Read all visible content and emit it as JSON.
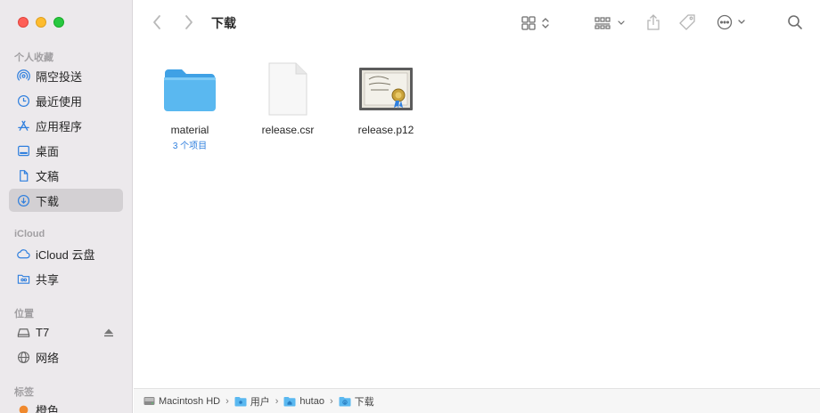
{
  "window": {
    "title": "下载"
  },
  "sidebar": {
    "sections": [
      {
        "title": "个人收藏"
      },
      {
        "title": "iCloud"
      },
      {
        "title": "位置"
      },
      {
        "title": "标签"
      }
    ],
    "favorites": [
      {
        "label": "隔空投送",
        "icon": "airdrop-icon"
      },
      {
        "label": "最近使用",
        "icon": "clock-icon"
      },
      {
        "label": "应用程序",
        "icon": "applications-icon"
      },
      {
        "label": "桌面",
        "icon": "desktop-icon"
      },
      {
        "label": "文稿",
        "icon": "document-icon"
      },
      {
        "label": "下载",
        "icon": "download-icon",
        "selected": true
      }
    ],
    "icloud": [
      {
        "label": "iCloud 云盘",
        "icon": "cloud-icon"
      },
      {
        "label": "共享",
        "icon": "shared-folder-icon"
      }
    ],
    "locations": [
      {
        "label": "T7",
        "icon": "drive-icon"
      },
      {
        "label": "网络",
        "icon": "network-icon"
      }
    ],
    "tags": [
      {
        "label": "橙色",
        "color": "#f0892e"
      }
    ]
  },
  "files": [
    {
      "name": "material",
      "sub": "3 个项目",
      "icon": "folder-icon"
    },
    {
      "name": "release.csr",
      "sub": "",
      "icon": "blank-document-icon"
    },
    {
      "name": "release.p12",
      "sub": "",
      "icon": "certificate-icon"
    }
  ],
  "pathbar": [
    {
      "label": "Macintosh HD",
      "icon": "hard-disk-icon"
    },
    {
      "label": "用户",
      "icon": "folder-icon"
    },
    {
      "label": "hutao",
      "icon": "home-folder-icon"
    },
    {
      "label": "下载",
      "icon": "downloads-folder-icon"
    }
  ],
  "colors": {
    "accent": "#2f7fde",
    "sidebar_bg": "#ece9ec",
    "folder": "#5ab8f0"
  }
}
